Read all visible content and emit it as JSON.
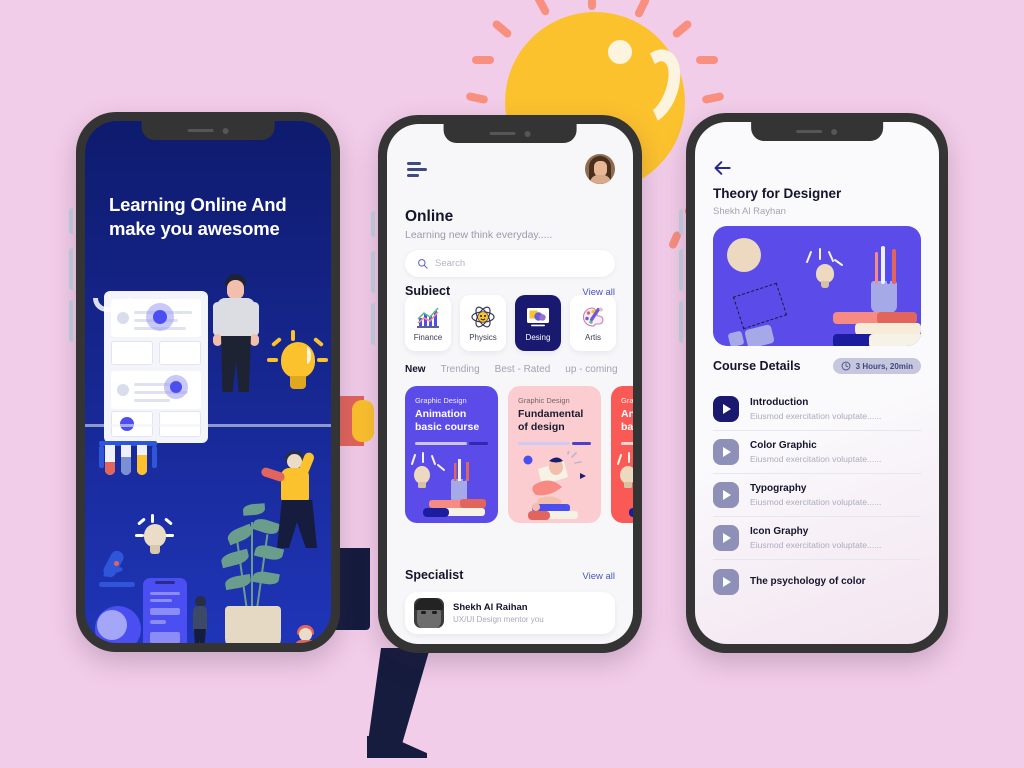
{
  "canvas": {
    "background_color": "#f2cde9"
  },
  "decor": {
    "sun": {
      "core_color": "#fcc22e",
      "highlight_color": "#fdf4e0",
      "ray_color": "#f98f7f",
      "ray_count": 14
    },
    "hand_color": "#e2655d",
    "leg_color": "#151c3e"
  },
  "phone1": {
    "screen_bg": "#0e1b6e",
    "headline_line1": "Learning Online And",
    "headline_line2": "make you awesome",
    "illustration_name": "online-learning-illustration"
  },
  "phone2": {
    "menu_icon": "hamburger-menu-icon",
    "avatar": "user-avatar",
    "title": "Online",
    "subtitle": "Learning new think everyday.....",
    "search": {
      "placeholder": "Search",
      "icon": "search-icon"
    },
    "subject_section": {
      "title": "Subject",
      "view_all": "View all"
    },
    "subjects": [
      {
        "label": "Finance",
        "icon": "bar-chart-icon",
        "active": false
      },
      {
        "label": "Physics",
        "icon": "atom-icon",
        "active": false
      },
      {
        "label": "Desing",
        "icon": "monitor-design-icon",
        "active": true
      },
      {
        "label": "Artis",
        "icon": "palette-brush-icon",
        "active": false
      }
    ],
    "tabs": [
      {
        "label": "New",
        "active": true
      },
      {
        "label": "Trending",
        "active": false
      },
      {
        "label": "Best - Rated",
        "active": false
      },
      {
        "label": "up - coming",
        "active": false
      }
    ],
    "courses": [
      {
        "category": "Graphic Design",
        "title": "Animation basic course",
        "color": "#5b4be8",
        "progress": 73
      },
      {
        "category": "Graphic Design",
        "title": "Fundamental of design",
        "color": "#fbcdd0",
        "progress": 73
      },
      {
        "category": "Graphic Design",
        "title": "Animation basic course",
        "color": "#fa5a56",
        "progress": 73
      }
    ],
    "specialist_section": {
      "title": "Specialist",
      "view_all": "View all"
    },
    "specialist": {
      "name": "Shekh Al Raihan",
      "role": "UX/UI Design mentor you"
    }
  },
  "phone3": {
    "back_icon": "back-arrow-icon",
    "title": "Theory for Designer",
    "author": "Shekh Al Rayhan",
    "hero_color": "#5b4be8",
    "hero_illustration": "design-tools-illustration",
    "course_details_title": "Course Details",
    "duration": {
      "text": "3 Hours, 20min",
      "icon": "clock-icon"
    },
    "lessons": [
      {
        "title": "Introduction",
        "subtitle": "Eiusmod exercitation voluptate......",
        "active": true
      },
      {
        "title": "Color Graphic",
        "subtitle": "Eiusmod exercitation voluptate......",
        "active": false
      },
      {
        "title": "Typography",
        "subtitle": "Eiusmod exercitation voluptate......",
        "active": false
      },
      {
        "title": "Icon Graphy",
        "subtitle": "Eiusmod exercitation voluptate......",
        "active": false
      },
      {
        "title": "The psychology of color",
        "subtitle": "",
        "active": false
      }
    ]
  }
}
